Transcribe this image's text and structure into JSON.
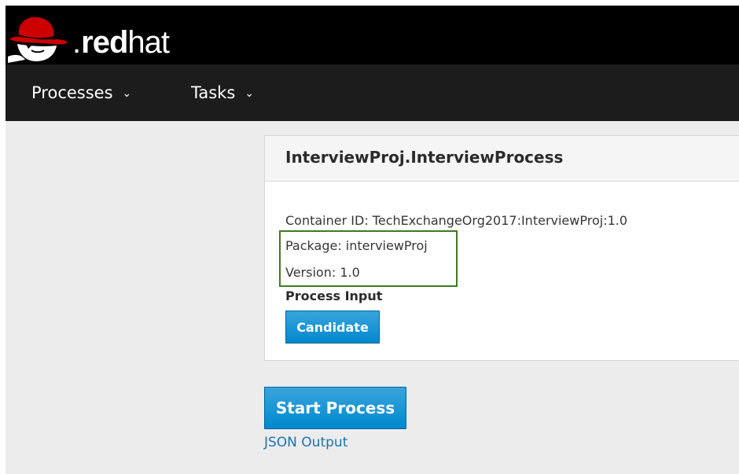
{
  "brand": {
    "logo_text_dot": ".",
    "logo_text_red": "red",
    "logo_text_hat": "hat",
    "logo_icon": "redhat-shadowman-icon",
    "colors": {
      "hat_red": "#cc0000",
      "bar_black": "#000000"
    }
  },
  "nav": {
    "items": [
      {
        "label": "Processes",
        "icon": "chevron-down-icon"
      },
      {
        "label": "Tasks",
        "icon": "chevron-down-icon"
      }
    ]
  },
  "process_card": {
    "title": "InterviewProj.InterviewProcess",
    "container_id": "Container ID: TechExchangeOrg2017:InterviewProj:1.0",
    "package": "Package: interviewProj",
    "version": "Version: 1.0",
    "section_label": "Process Input",
    "candidate_button": "Candidate",
    "highlight_color": "#3e7a1f"
  },
  "actions": {
    "start_button": "Start Process",
    "json_link": "JSON Output",
    "accent": "#0088ce"
  }
}
